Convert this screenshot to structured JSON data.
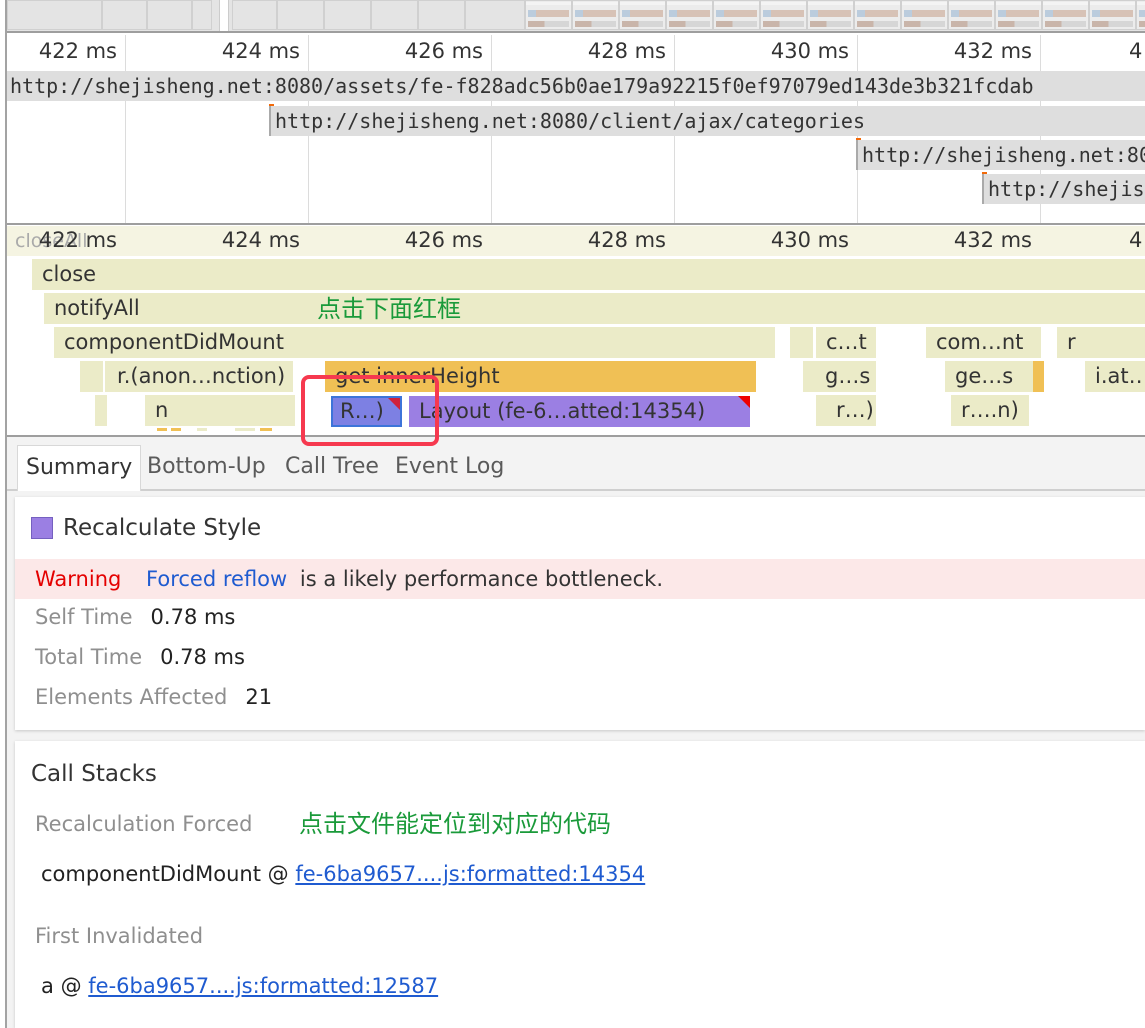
{
  "timeline": {
    "ticks": [
      "422 ms",
      "424 ms",
      "426 ms",
      "428 ms",
      "430 ms",
      "432 ms",
      "4"
    ]
  },
  "network": {
    "requests": [
      {
        "url": "http://shejisheng.net:8080/assets/fe-f828adc56b0ae179a92215f0ef97079ed143de3b321fcdab",
        "marker": "red"
      },
      {
        "url": "http://shejisheng.net:8080/client/ajax/categories",
        "marker": "orange"
      },
      {
        "url": "http://shejisheng.net:80",
        "marker": "orange"
      },
      {
        "url": "http://shejish",
        "marker": "orange"
      }
    ]
  },
  "flame": {
    "ghost_label": "closeAll",
    "bars": {
      "close": "close",
      "notifyAll": "notifyAll",
      "componentDidMount": "componentDidMount",
      "anon": "r.(anon…nction)",
      "getInnerHeight": "get innerHeight",
      "n": "n",
      "recalc": "R…)",
      "layout": "Layout (fe-6…atted:14354)",
      "ct": "c…t",
      "gs": "g…s",
      "rparen": "r…)",
      "comnt": "com…nt",
      "ges": "ge…s",
      "rn": "r….n)",
      "r": "r",
      "iat": "i.at…"
    },
    "annotation_top": "点击下面红框"
  },
  "tabs": [
    {
      "label": "Summary",
      "active": true
    },
    {
      "label": "Bottom-Up",
      "active": false
    },
    {
      "label": "Call Tree",
      "active": false
    },
    {
      "label": "Event Log",
      "active": false
    }
  ],
  "summary": {
    "event_title": "Recalculate Style",
    "event_color": "#9b7fe3",
    "warning": {
      "label": "Warning",
      "link": "Forced reflow",
      "text": "is a likely performance bottleneck."
    },
    "self_time": {
      "label": "Self Time",
      "value": "0.78 ms"
    },
    "total_time": {
      "label": "Total Time",
      "value": "0.78 ms"
    },
    "elements_affected": {
      "label": "Elements Affected",
      "value": "21"
    }
  },
  "call_stacks": {
    "title": "Call Stacks",
    "annotation": "点击文件能定位到对应的代码",
    "recalculation_forced": {
      "label": "Recalculation Forced",
      "function": "componentDidMount",
      "at": "@",
      "link": "fe-6ba9657....js:formatted:14354"
    },
    "first_invalidated": {
      "label": "First Invalidated",
      "function": "a",
      "at": "@",
      "link": "fe-6ba9657....js:formatted:12587"
    }
  }
}
